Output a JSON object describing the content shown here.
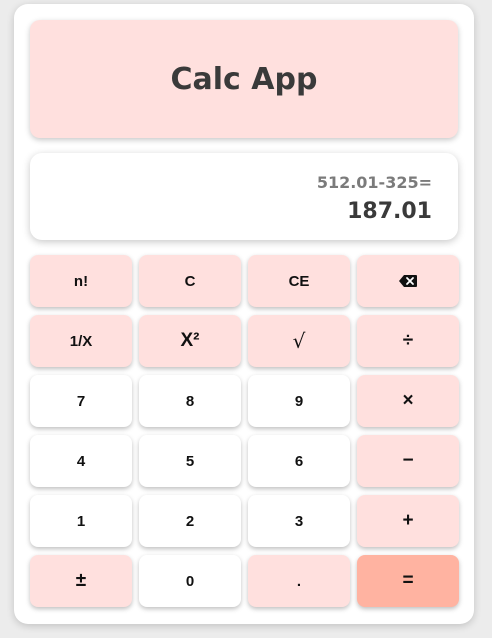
{
  "app": {
    "title": "Calc App"
  },
  "display": {
    "expression": "512.01-325=",
    "result": "187.01"
  },
  "keys": {
    "factorial": "n!",
    "clear": "C",
    "clear_entry": "CE",
    "backspace_icon": "backspace-icon",
    "reciprocal": "1/X",
    "square": "X²",
    "sqrt": "√",
    "divide": "÷",
    "seven": "7",
    "eight": "8",
    "nine": "9",
    "multiply": "×",
    "four": "4",
    "five": "5",
    "six": "6",
    "minus": "−",
    "one": "1",
    "two": "2",
    "three": "3",
    "plus": "+",
    "negate": "±",
    "zero": "0",
    "decimal": ".",
    "equals": "="
  },
  "colors": {
    "pink": "#ffe0de",
    "equals": "#ffb3a1",
    "text": "#3a3a3a"
  }
}
